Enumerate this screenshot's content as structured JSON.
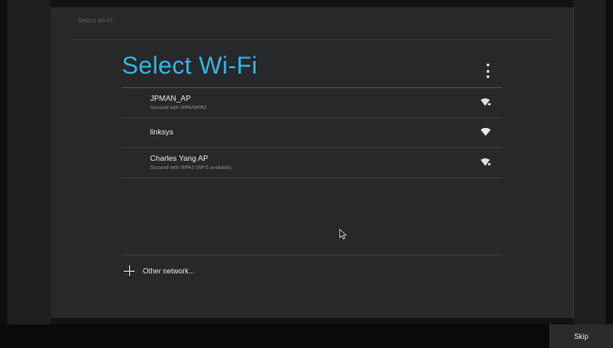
{
  "header": {
    "title": "Select Wi-Fi"
  },
  "page": {
    "title": "Select Wi-Fi",
    "overflow_icon": "overflow-menu-icon"
  },
  "networks": [
    {
      "name": "JPMAN_AP",
      "subtitle": "Secured with WPA/WPA2",
      "secured": true,
      "icon": "wifi-locked-icon"
    },
    {
      "name": "linksys",
      "subtitle": "",
      "secured": false,
      "icon": "wifi-icon"
    },
    {
      "name": "Charles Yang AP",
      "subtitle": "Secured with WPA2 (WPS available)",
      "secured": true,
      "icon": "wifi-locked-icon"
    }
  ],
  "other_network": {
    "label": "Other network...",
    "icon": "plus-icon"
  },
  "footer": {
    "skip_label": "Skip"
  },
  "colors": {
    "accent": "#33b5e5",
    "panel": "#272829",
    "background": "#111213"
  }
}
